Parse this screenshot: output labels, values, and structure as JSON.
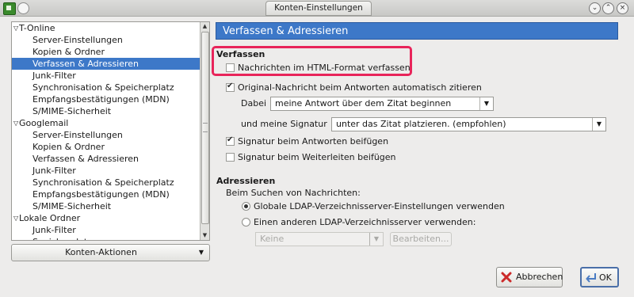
{
  "window": {
    "title": "Konten-Einstellungen"
  },
  "tree": {
    "items": [
      {
        "label": "T-Online",
        "level": 0
      },
      {
        "label": "Server-Einstellungen",
        "level": 1
      },
      {
        "label": "Kopien & Ordner",
        "level": 1
      },
      {
        "label": "Verfassen & Adressieren",
        "level": 1,
        "selected": true
      },
      {
        "label": "Junk-Filter",
        "level": 1
      },
      {
        "label": "Synchronisation & Speicherplatz",
        "level": 1
      },
      {
        "label": "Empfangsbestätigungen (MDN)",
        "level": 1
      },
      {
        "label": "S/MIME-Sicherheit",
        "level": 1
      },
      {
        "label": "Googlemail",
        "level": 0
      },
      {
        "label": "Server-Einstellungen",
        "level": 1
      },
      {
        "label": "Kopien & Ordner",
        "level": 1
      },
      {
        "label": "Verfassen & Adressieren",
        "level": 1
      },
      {
        "label": "Junk-Filter",
        "level": 1
      },
      {
        "label": "Synchronisation & Speicherplatz",
        "level": 1
      },
      {
        "label": "Empfangsbestätigungen (MDN)",
        "level": 1
      },
      {
        "label": "S/MIME-Sicherheit",
        "level": 1
      },
      {
        "label": "Lokale Ordner",
        "level": 0
      },
      {
        "label": "Junk-Filter",
        "level": 1
      },
      {
        "label": "Speicherplatz",
        "level": 1
      }
    ],
    "account_actions_label": "Konten-Aktionen"
  },
  "panel": {
    "header": "Verfassen & Adressieren",
    "compose_section": "Verfassen",
    "html_format_label": "Nachrichten im HTML-Format verfassen",
    "quote_label": "Original-Nachricht beim Antworten automatisch zitieren",
    "then_label": "Dabei",
    "then_value": "meine Antwort über dem Zitat beginnen",
    "signature_label": "und meine Signatur",
    "signature_value": "unter das Zitat platzieren. (empfohlen)",
    "sig_reply_label": "Signatur beim Antworten beifügen",
    "sig_forward_label": "Signatur beim Weiterleiten beifügen",
    "addressing_section": "Adressieren",
    "search_label": "Beim Suchen von Nachrichten:",
    "global_ldap_label": "Globale LDAP-Verzeichnisserver-Einstellungen verwenden",
    "other_ldap_label": "Einen anderen LDAP-Verzeichnisserver verwenden:",
    "ldap_value": "Keine",
    "edit_label": "Bearbeiten..."
  },
  "buttons": {
    "cancel": "Abbrechen",
    "ok": "OK"
  },
  "state": {
    "html_format": false,
    "quote": true,
    "sig_reply": true,
    "sig_forward": false,
    "ldap_choice": "global"
  }
}
